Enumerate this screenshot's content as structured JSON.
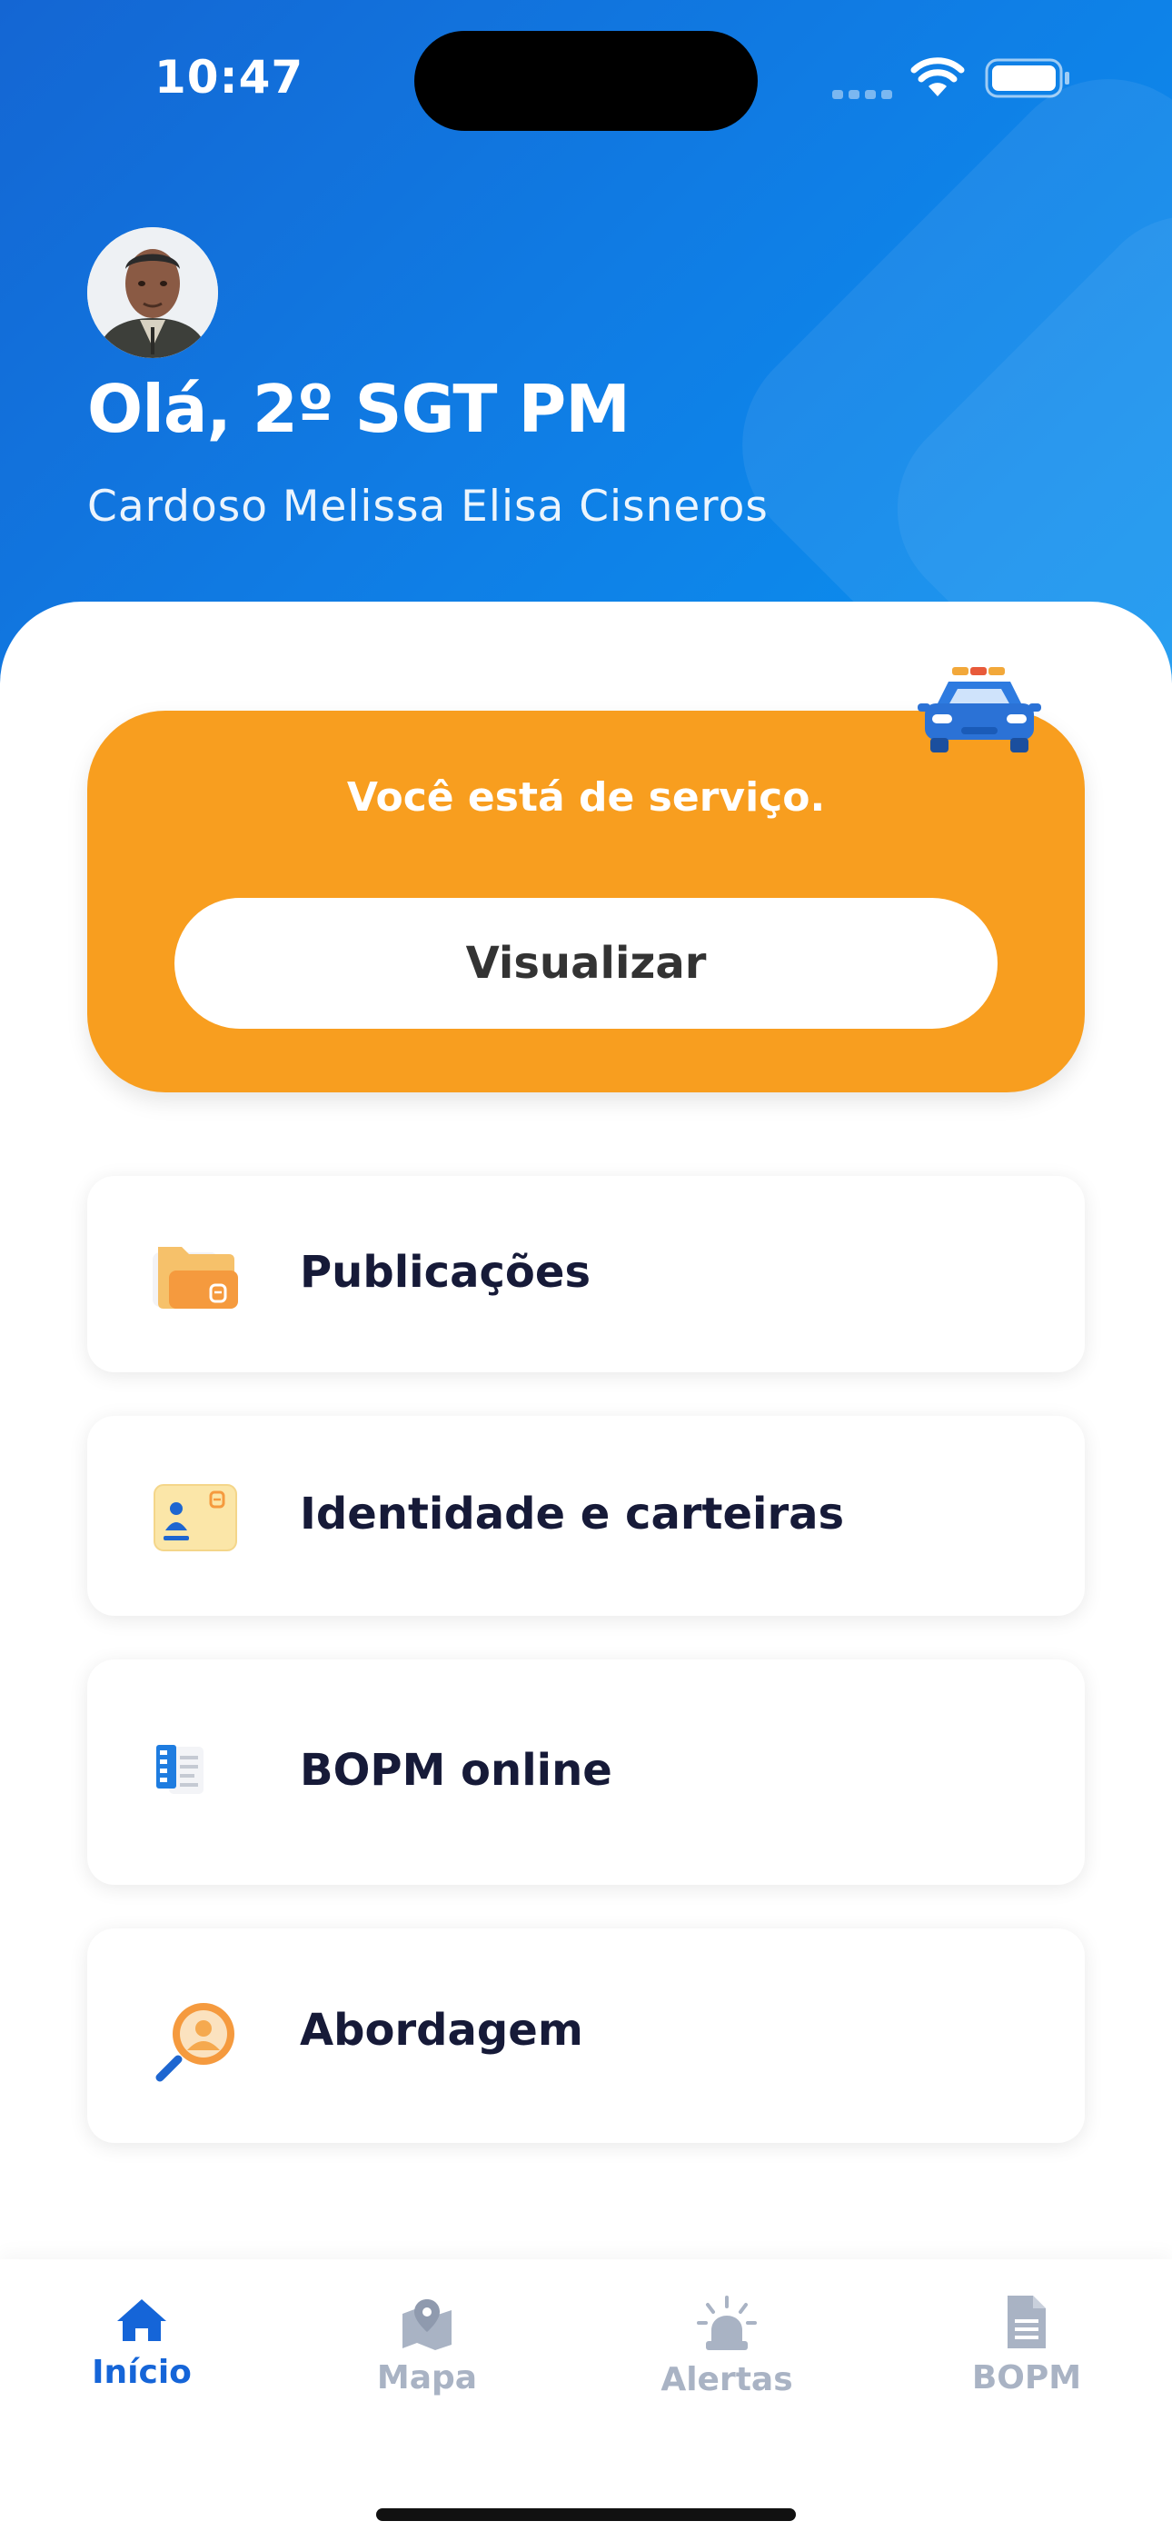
{
  "status_bar": {
    "time": "10:47"
  },
  "header": {
    "greeting": "Olá, 2º SGT PM",
    "user_name": "Cardoso Melissa Elisa Cisneros"
  },
  "duty_card": {
    "message": "Você está de serviço.",
    "button_label": "Visualizar"
  },
  "menu": {
    "items": [
      {
        "label": "Publicações",
        "icon": "folder-icon"
      },
      {
        "label": "Identidade e carteiras",
        "icon": "id-card-icon"
      },
      {
        "label": "BOPM online",
        "icon": "document-icon"
      },
      {
        "label": "Abordagem",
        "icon": "search-person-icon"
      }
    ]
  },
  "bottom_nav": {
    "items": [
      {
        "label": "Início",
        "icon": "home-icon",
        "active": true
      },
      {
        "label": "Mapa",
        "icon": "map-icon",
        "active": false
      },
      {
        "label": "Alertas",
        "icon": "siren-icon",
        "active": false
      },
      {
        "label": "BOPM",
        "icon": "file-icon",
        "active": false
      }
    ]
  },
  "colors": {
    "header_blue": "#1466d3",
    "accent_orange": "#f89e1f",
    "active_nav": "#1565d8",
    "inactive_nav": "#a9b3c4"
  }
}
